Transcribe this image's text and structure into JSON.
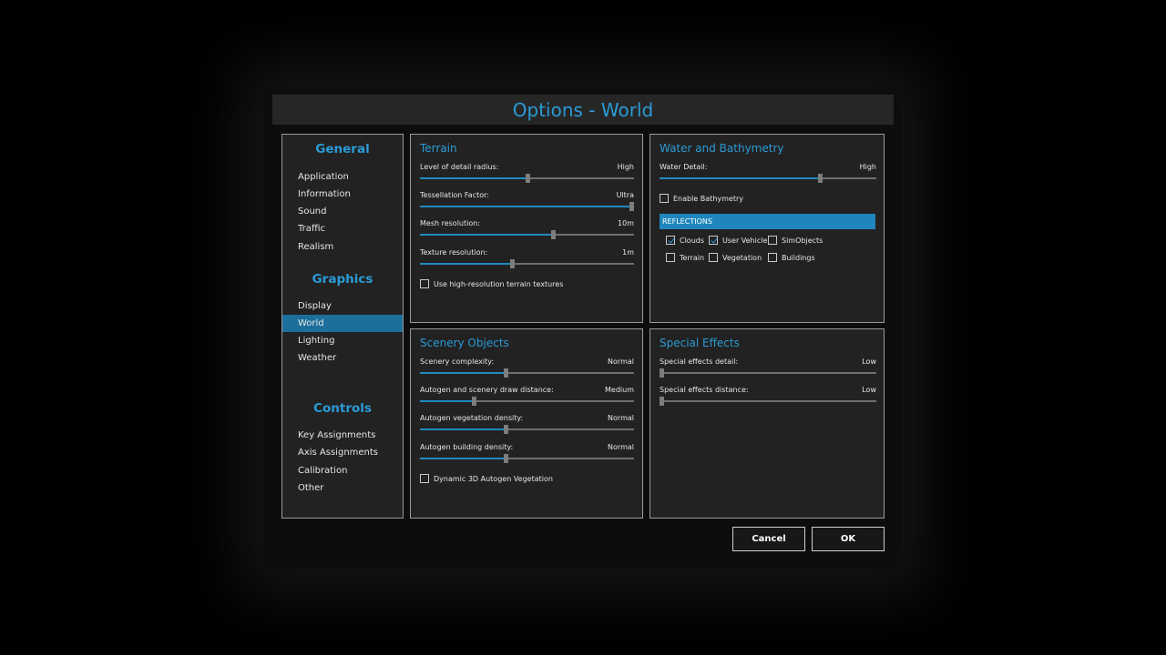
{
  "title": "Options - World",
  "sidebar": {
    "categories": [
      {
        "heading": "General",
        "items": [
          "Application",
          "Information",
          "Sound",
          "Traffic",
          "Realism"
        ]
      },
      {
        "heading": "Graphics",
        "items": [
          "Display",
          "World",
          "Lighting",
          "Weather"
        ]
      },
      {
        "heading": "Controls",
        "items": [
          "Key Assignments",
          "Axis Assignments",
          "Calibration",
          "Other"
        ]
      }
    ],
    "selected": "World"
  },
  "terrain": {
    "title": "Terrain",
    "sliders": [
      {
        "label": "Level of detail radius:",
        "value": "High",
        "level": 0.5
      },
      {
        "label": "Tessellation Factor:",
        "value": "Ultra",
        "level": 1.0
      },
      {
        "label": "Mesh resolution:",
        "value": "10m",
        "level": 0.62
      },
      {
        "label": "Texture resolution:",
        "value": "1m",
        "level": 0.43
      }
    ],
    "checkbox": {
      "label": "Use high-resolution terrain textures",
      "checked": false
    }
  },
  "water": {
    "title": "Water and Bathymetry",
    "sliders": [
      {
        "label": "Water Detail:",
        "value": "High",
        "level": 0.74
      }
    ],
    "bathymetry": {
      "label": "Enable Bathymetry",
      "checked": false
    },
    "reflections_heading": "REFLECTIONS",
    "reflections": [
      {
        "label": "Clouds",
        "checked": true
      },
      {
        "label": "User Vehicle",
        "checked": true
      },
      {
        "label": "SimObjects",
        "checked": false
      },
      {
        "label": "Terrain",
        "checked": false
      },
      {
        "label": "Vegetation",
        "checked": false
      },
      {
        "label": "Buildings",
        "checked": false
      }
    ]
  },
  "scenery": {
    "title": "Scenery Objects",
    "sliders": [
      {
        "label": "Scenery complexity:",
        "value": "Normal",
        "level": 0.4
      },
      {
        "label": "Autogen and scenery draw distance:",
        "value": "Medium",
        "level": 0.25
      },
      {
        "label": "Autogen vegetation density:",
        "value": "Normal",
        "level": 0.4
      },
      {
        "label": "Autogen building density:",
        "value": "Normal",
        "level": 0.4
      }
    ],
    "checkbox": {
      "label": "Dynamic 3D Autogen Vegetation",
      "checked": false
    }
  },
  "effects": {
    "title": "Special Effects",
    "sliders": [
      {
        "label": "Special effects detail:",
        "value": "Low",
        "level": 0.0
      },
      {
        "label": "Special effects distance:",
        "value": "Low",
        "level": 0.0
      }
    ]
  },
  "buttons": {
    "cancel": "Cancel",
    "ok": "OK"
  },
  "colors": {
    "accent": "#2a9bd6",
    "selected": "#1d6f9b",
    "panel": "#222222",
    "fill": "#1f8ac0"
  }
}
